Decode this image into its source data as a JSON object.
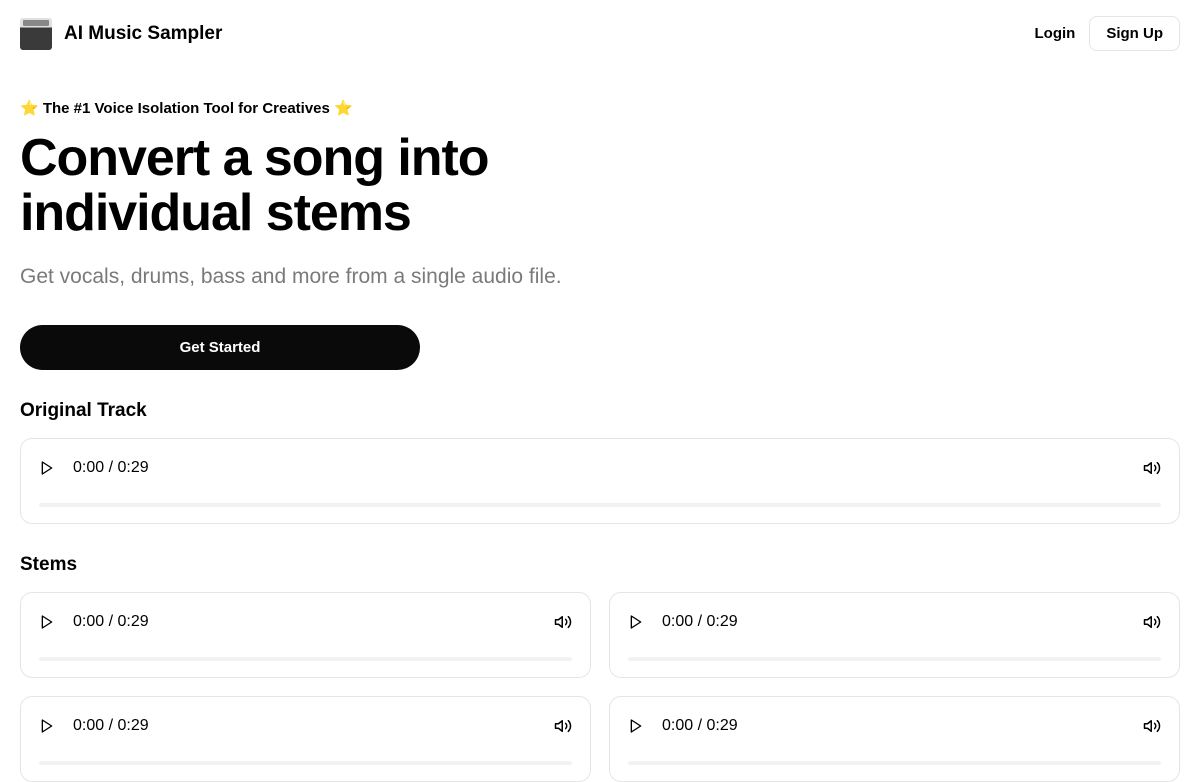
{
  "header": {
    "brand_name": "AI Music Sampler",
    "login_label": "Login",
    "signup_label": "Sign Up"
  },
  "hero": {
    "badge_text": "⭐ The #1 Voice Isolation Tool for Creatives ⭐",
    "title": "Convert a song into individual stems",
    "subtitle": "Get vocals, drums, bass and more from a single audio file.",
    "cta_label": "Get Started"
  },
  "sections": {
    "original_label": "Original Track",
    "stems_label": "Stems"
  },
  "original_player": {
    "current_time": "0:00",
    "duration": "0:29",
    "time_display": "0:00 / 0:29"
  },
  "stems": [
    {
      "current_time": "0:00",
      "duration": "0:29",
      "time_display": "0:00 / 0:29"
    },
    {
      "current_time": "0:00",
      "duration": "0:29",
      "time_display": "0:00 / 0:29"
    },
    {
      "current_time": "0:00",
      "duration": "0:29",
      "time_display": "0:00 / 0:29"
    },
    {
      "current_time": "0:00",
      "duration": "0:29",
      "time_display": "0:00 / 0:29"
    }
  ]
}
